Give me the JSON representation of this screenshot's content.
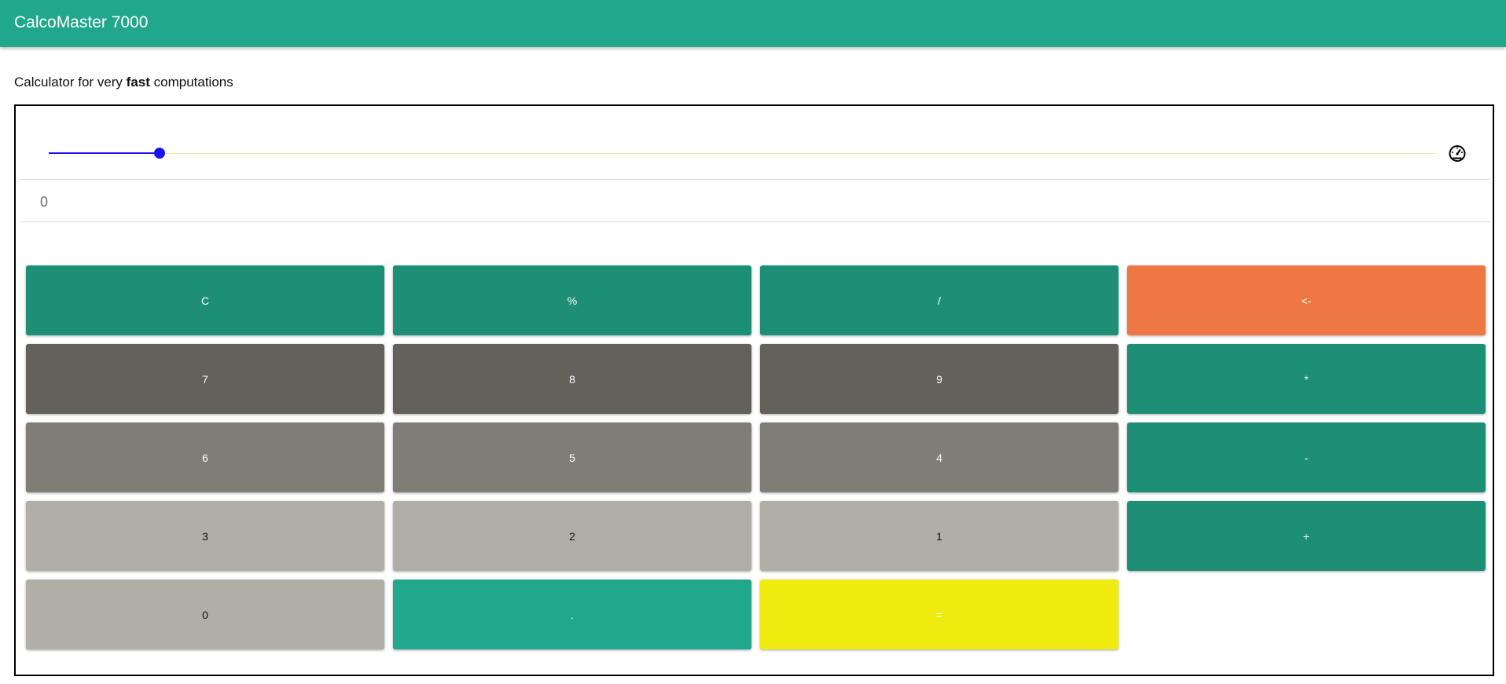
{
  "app": {
    "title": "CalcoMaster 7000"
  },
  "subtitle": {
    "before": "Calculator for very ",
    "emphasis": "fast",
    "after": " computations"
  },
  "speed": {
    "level": 0.08,
    "icon": "speedometer-icon",
    "colors": {
      "fill": "#1a12f0",
      "track": "#f3e7a8"
    }
  },
  "display": {
    "value": "0"
  },
  "keys": [
    {
      "label": "C",
      "name": "clear-button",
      "bg": "#1e8f77",
      "fg": "#ffffff"
    },
    {
      "label": "%",
      "name": "percent-button",
      "bg": "#1e8f77",
      "fg": "#ffffff"
    },
    {
      "label": "/",
      "name": "divide-button",
      "bg": "#1e8f77",
      "fg": "#ffffff"
    },
    {
      "label": "<-",
      "name": "backspace-button",
      "bg": "#ee7744",
      "fg": "#ffffff"
    },
    {
      "label": "7",
      "name": "digit-7-button",
      "bg": "#64605a",
      "fg": "#ffffff"
    },
    {
      "label": "8",
      "name": "digit-8-button",
      "bg": "#64605a",
      "fg": "#ffffff"
    },
    {
      "label": "9",
      "name": "digit-9-button",
      "bg": "#64605a",
      "fg": "#ffffff"
    },
    {
      "label": "*",
      "name": "multiply-button",
      "bg": "#1e8f77",
      "fg": "#ffffff"
    },
    {
      "label": "6",
      "name": "digit-6-button",
      "bg": "#807c76",
      "fg": "#ffffff"
    },
    {
      "label": "5",
      "name": "digit-5-button",
      "bg": "#807c76",
      "fg": "#ffffff"
    },
    {
      "label": "4",
      "name": "digit-4-button",
      "bg": "#807c76",
      "fg": "#ffffff"
    },
    {
      "label": "-",
      "name": "subtract-button",
      "bg": "#1e8f77",
      "fg": "#ffffff"
    },
    {
      "label": "3",
      "name": "digit-3-button",
      "bg": "#b1ada7",
      "fg": "#111111"
    },
    {
      "label": "2",
      "name": "digit-2-button",
      "bg": "#b1ada7",
      "fg": "#111111"
    },
    {
      "label": "1",
      "name": "digit-1-button",
      "bg": "#b1ada7",
      "fg": "#111111"
    },
    {
      "label": "+",
      "name": "add-button",
      "bg": "#1e8f77",
      "fg": "#ffffff"
    },
    {
      "label": "0",
      "name": "digit-0-button",
      "bg": "#b1ada7",
      "fg": "#111111"
    },
    {
      "label": ".",
      "name": "decimal-button",
      "bg": "#21a78b",
      "fg": "#ffffff"
    },
    {
      "label": "=",
      "name": "equals-button",
      "bg": "#efeb0e",
      "fg": "#ffffff"
    }
  ]
}
